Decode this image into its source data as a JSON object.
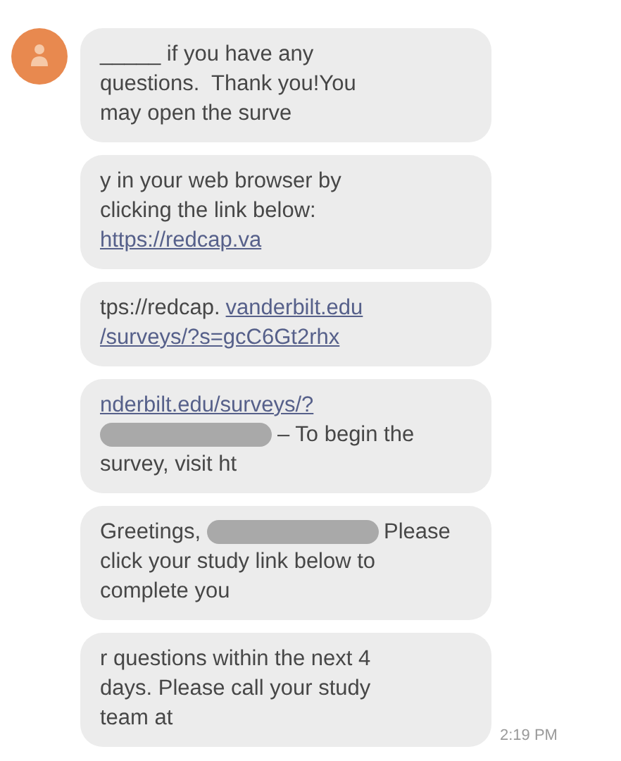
{
  "conversation": {
    "messages": [
      {
        "lines": [
          [
            {
              "kind": "text",
              "text": "_____ if you have any"
            }
          ],
          [
            {
              "kind": "text",
              "text": "questions.  Thank you!You"
            }
          ],
          [
            {
              "kind": "text",
              "text": "may open the surve"
            }
          ]
        ]
      },
      {
        "lines": [
          [
            {
              "kind": "text",
              "text": "y in your web browser by"
            }
          ],
          [
            {
              "kind": "text",
              "text": "clicking the link below:"
            }
          ],
          [
            {
              "kind": "link",
              "text": "https://redcap.va"
            }
          ]
        ]
      },
      {
        "lines": [
          [
            {
              "kind": "text",
              "text": "tps://redcap."
            },
            {
              "kind": "link",
              "text": "vanderbilt.edu"
            }
          ],
          [
            {
              "kind": "link",
              "text": "/surveys/?s=gcC6Gt2rhx"
            }
          ]
        ]
      },
      {
        "lines": [
          [
            {
              "kind": "link",
              "text": "nderbilt.edu/surveys/?"
            }
          ],
          [
            {
              "kind": "redacted"
            },
            {
              "kind": "text",
              "text": "– To begin the"
            }
          ],
          [
            {
              "kind": "text",
              "text": "survey, visit ht"
            }
          ]
        ]
      },
      {
        "lines": [
          [
            {
              "kind": "text",
              "text": "Greetings,"
            },
            {
              "kind": "redacted"
            },
            {
              "kind": "text",
              "text": "Please"
            }
          ],
          [
            {
              "kind": "text",
              "text": "click your study link below to"
            }
          ],
          [
            {
              "kind": "text",
              "text": "complete you"
            }
          ]
        ]
      },
      {
        "lines": [
          [
            {
              "kind": "text",
              "text": "r questions within the next 4"
            }
          ],
          [
            {
              "kind": "text",
              "text": "days. Please call your study"
            }
          ],
          [
            {
              "kind": "text",
              "text": "team at"
            }
          ]
        ],
        "time": "2:19 PM"
      }
    ]
  }
}
